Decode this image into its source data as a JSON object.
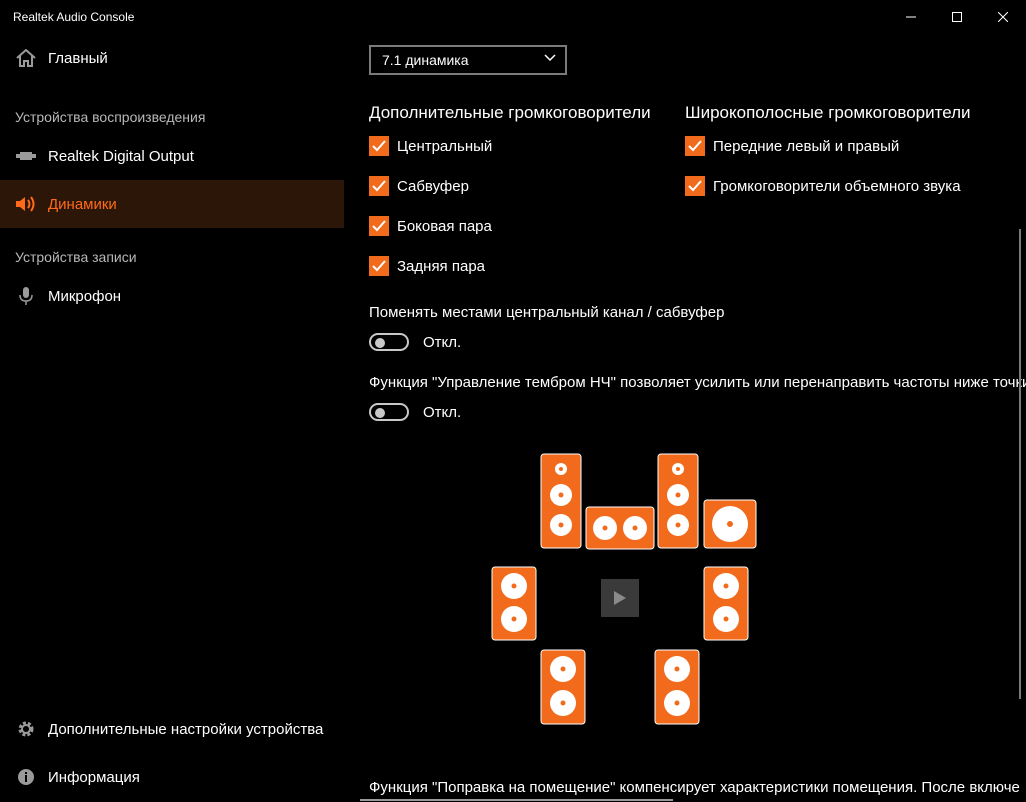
{
  "app": {
    "title": "Realtek Audio Console"
  },
  "window_controls": {
    "minimize": "minimize-icon",
    "maximize": "maximize-icon",
    "close": "close-icon"
  },
  "sidebar": {
    "main_item": {
      "label": "Главный",
      "icon": "home-icon"
    },
    "playback_header": "Устройства воспроизведения",
    "playback_items": [
      {
        "label": "Realtek Digital Output",
        "icon": "digital-output-icon"
      },
      {
        "label": "Динамики",
        "icon": "speaker-icon",
        "active": true
      }
    ],
    "record_header": "Устройства записи",
    "record_items": [
      {
        "label": "Микрофон",
        "icon": "microphone-icon"
      }
    ],
    "bottom_items": [
      {
        "label": "Дополнительные настройки устройства",
        "icon": "gear-icon"
      },
      {
        "label": "Информация",
        "icon": "info-icon"
      }
    ]
  },
  "main": {
    "config_dropdown": {
      "value": "7.1 динамика"
    },
    "extra_speakers": {
      "title": "Дополнительные громкоговорители",
      "items": [
        {
          "label": "Центральный",
          "checked": true
        },
        {
          "label": "Сабвуфер",
          "checked": true
        },
        {
          "label": "Боковая пара",
          "checked": true
        },
        {
          "label": "Задняя пара",
          "checked": true
        }
      ]
    },
    "fullrange_speakers": {
      "title": "Широкополосные громкоговорители",
      "items": [
        {
          "label": "Передние левый и правый",
          "checked": true
        },
        {
          "label": "Громкоговорители объемного звука",
          "checked": true
        }
      ]
    },
    "swap_center_sub": {
      "label": "Поменять местами центральный канал / сабвуфер",
      "state": "Откл."
    },
    "bass_management": {
      "label": "Функция \"Управление тембром НЧ\" позволяет усилить или перенаправить частоты ниже точки",
      "state": "Откл."
    },
    "room_correction": {
      "label": "Функция \"Поправка на помещение\" компенсирует характеристики помещения. После включе"
    },
    "accent_color": "#f26a1b"
  }
}
